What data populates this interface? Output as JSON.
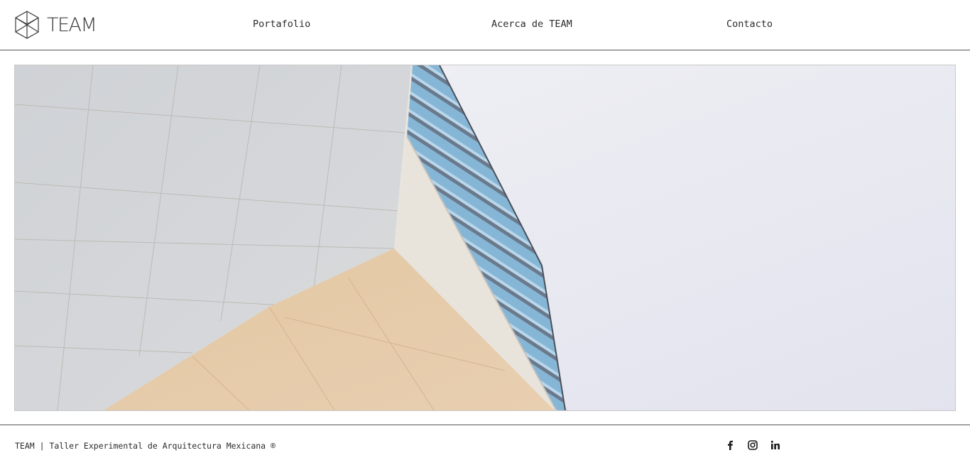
{
  "brand": {
    "name": "TEAM",
    "logo_icon": "cube-logo-icon"
  },
  "nav": {
    "items": [
      {
        "label": "Portafolio"
      },
      {
        "label": "Acerca de TEAM"
      },
      {
        "label": "Contacto"
      }
    ]
  },
  "hero": {
    "image": "architecture-building-facade-photo"
  },
  "footer": {
    "text": "TEAM | Taller Experimental de Arquitectura Mexicana ®",
    "social": [
      {
        "icon": "facebook-icon"
      },
      {
        "icon": "instagram-icon"
      },
      {
        "icon": "linkedin-icon"
      }
    ]
  },
  "colors": {
    "text": "#2b2b2b",
    "rule": "#555555",
    "glass": "#7fb2d6"
  }
}
